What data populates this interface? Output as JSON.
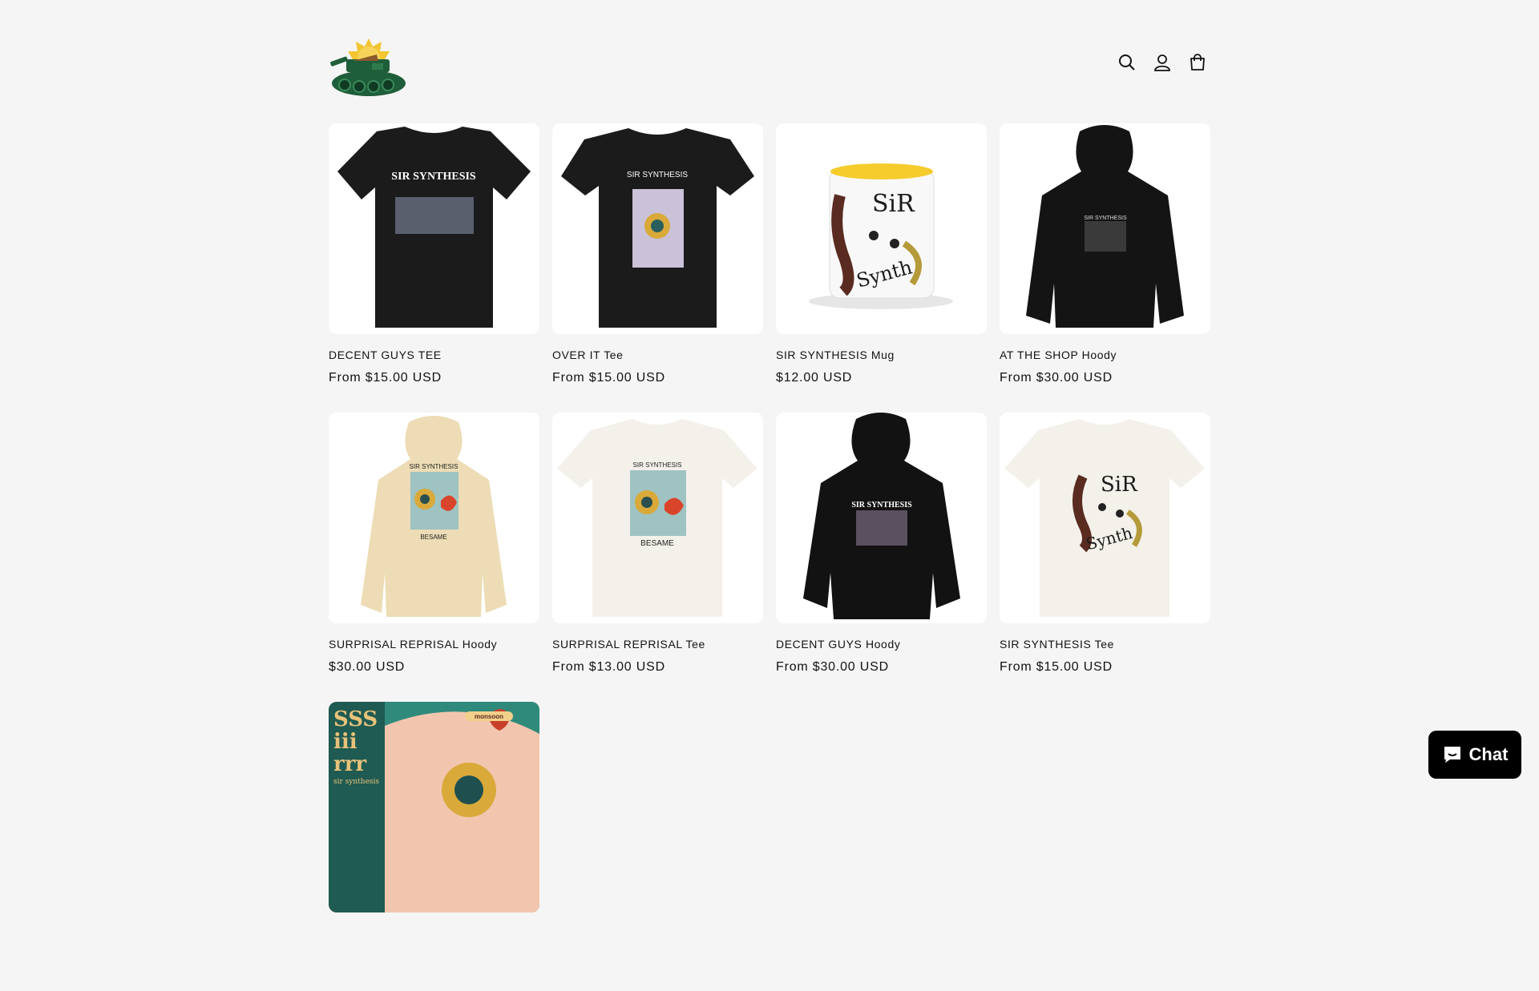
{
  "header": {
    "logo_alt": "store logo",
    "icons": [
      "search-icon",
      "account-icon",
      "cart-icon"
    ]
  },
  "products": [
    {
      "title": "DECENT GUYS TEE",
      "price": "From $15.00 USD",
      "image": "black-tee"
    },
    {
      "title": "OVER IT Tee",
      "price": "From $15.00 USD",
      "image": "black-tee-eye"
    },
    {
      "title": "SIR SYNTHESIS Mug",
      "price": "$12.00 USD",
      "image": "mug"
    },
    {
      "title": "AT THE SHOP Hoody",
      "price": "From $30.00 USD",
      "image": "black-hoody"
    },
    {
      "title": "SURPRISAL REPRISAL Hoody",
      "price": "$30.00 USD",
      "image": "cream-hoody"
    },
    {
      "title": "SURPRISAL REPRISAL Tee",
      "price": "From $13.00 USD",
      "image": "white-tee-eye"
    },
    {
      "title": "DECENT GUYS Hoody",
      "price": "From $30.00 USD",
      "image": "black-hoody-band"
    },
    {
      "title": "SIR SYNTHESIS Tee",
      "price": "From $15.00 USD",
      "image": "white-tee-logo"
    },
    {
      "title": "",
      "price": "",
      "image": "poster"
    }
  ],
  "print_text": {
    "sir_synthesis": "SIR SYNTHESIS",
    "besame": "BESAME",
    "monsoon": "monsoon",
    "sir_synthesis_lower": "sir synthesis"
  },
  "chat": {
    "label": "Chat",
    "icon": "chat-bubble-icon"
  },
  "colors": {
    "background": "#f5f5f5",
    "card": "#ffffff",
    "chat": "#000000",
    "tank": "#1f5e3a",
    "sun": "#f2c531"
  }
}
